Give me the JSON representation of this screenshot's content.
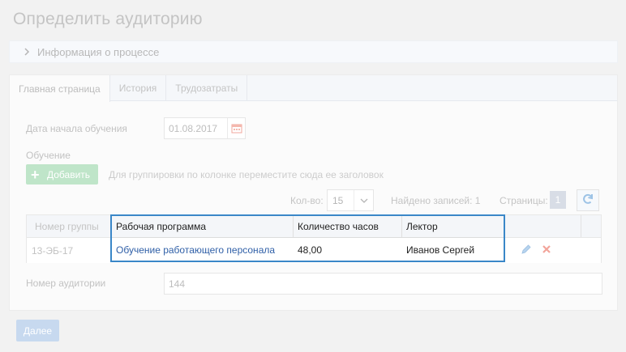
{
  "page": {
    "title": "Определить аудиторию"
  },
  "info_bar": {
    "label": "Информация о процессе"
  },
  "tabs": [
    {
      "label": "Главная страница",
      "active": true
    },
    {
      "label": "История",
      "active": false
    },
    {
      "label": "Трудозатраты",
      "active": false
    }
  ],
  "form": {
    "start_date_label": "Дата начала обучения",
    "start_date_value": "01.08.2017",
    "training_label": "Обучение",
    "add_button_label": "Добавить",
    "group_hint": "Для группировки по колонке переместите сюда ее заголовок",
    "room_label": "Номер аудитории",
    "room_value": "144"
  },
  "pager": {
    "qty_label": "Кол-во:",
    "qty_value": "15",
    "found_label": "Найдено записей: 1",
    "pages_label": "Страницы:",
    "current_page": "1"
  },
  "table": {
    "columns": [
      "Номер группы",
      "Рабочая программа",
      "Количество часов",
      "Лектор"
    ],
    "rows": [
      {
        "group": "13-ЭБ-17",
        "program": "Обучение работающего персонала",
        "hours": "48,00",
        "lecturer": "Иванов Сергей"
      }
    ]
  },
  "footer": {
    "next_button_label": "Далее"
  },
  "colors": {
    "highlight": "#3a87c8",
    "link": "#2f5fa7",
    "add_button": "#bfe5c9",
    "next_button": "#c7d9ef"
  }
}
